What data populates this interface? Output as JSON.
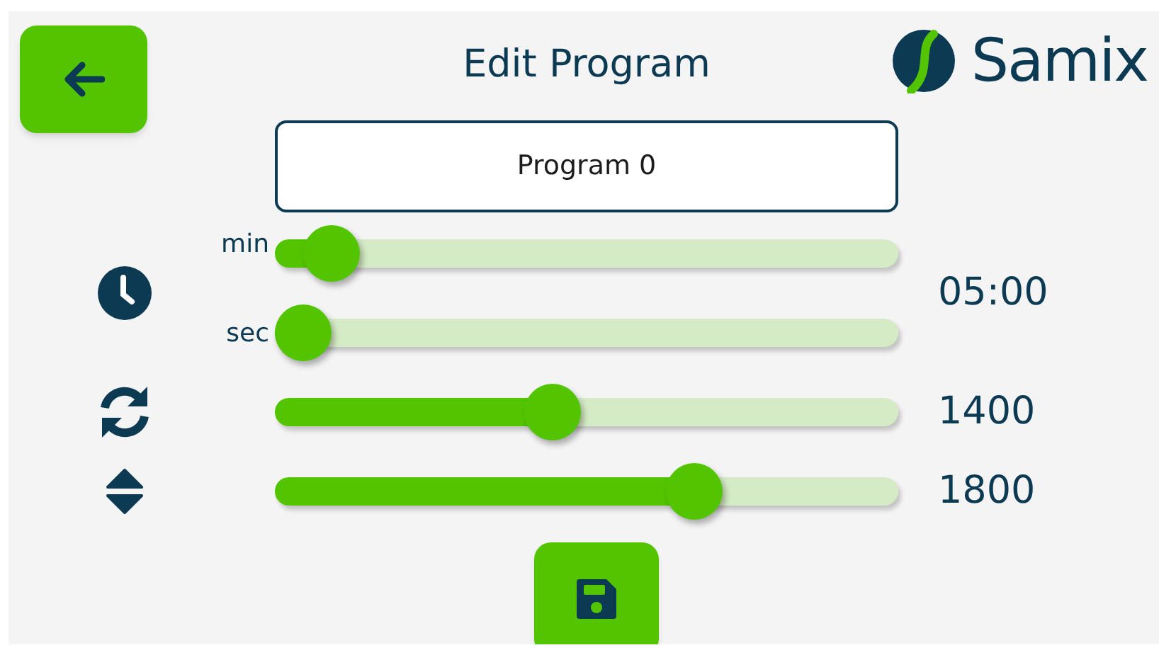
{
  "header": {
    "title": "Edit Program",
    "logo": "Samix"
  },
  "program_name": {
    "value": "Program 0"
  },
  "timer": {
    "sliders": [
      {
        "label": "min",
        "level": 0.05
      },
      {
        "label": "sec",
        "level": 0
      }
    ],
    "reading": "05:00"
  },
  "speed": {
    "level": 0.44,
    "reading": "1400"
  },
  "lift": {
    "level": 0.69,
    "reading": "1800"
  }
}
